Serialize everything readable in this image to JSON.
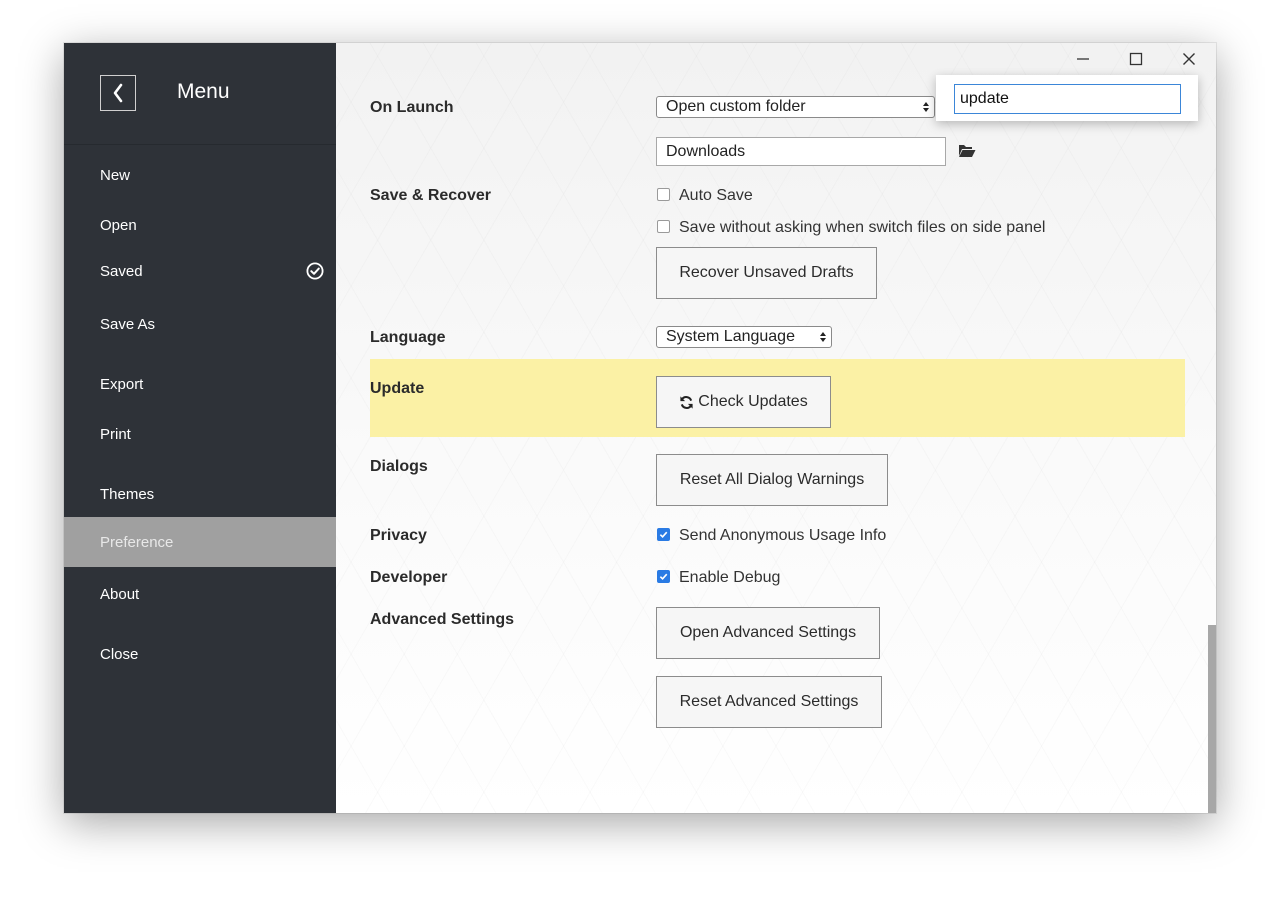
{
  "sidebar": {
    "title": "Menu",
    "items": [
      {
        "label": "New"
      },
      {
        "label": "Open"
      },
      {
        "label": "Saved"
      },
      {
        "label": "Save As"
      },
      {
        "label": "Export"
      },
      {
        "label": "Print"
      },
      {
        "label": "Themes"
      },
      {
        "label": "Preference"
      },
      {
        "label": "About"
      },
      {
        "label": "Close"
      }
    ],
    "active_item": "Preference"
  },
  "settings": {
    "on_launch": {
      "label": "On Launch",
      "select_value": "Open custom folder",
      "folder_value": "Downloads"
    },
    "save_recover": {
      "label": "Save & Recover",
      "auto_save": {
        "label": "Auto Save",
        "checked": false
      },
      "save_without_asking": {
        "label": "Save without asking when switch files on side panel",
        "checked": false
      },
      "recover_button": "Recover Unsaved Drafts"
    },
    "language": {
      "label": "Language",
      "select_value": "System Language"
    },
    "update": {
      "label": "Update",
      "button": "Check Updates"
    },
    "dialogs": {
      "label": "Dialogs",
      "button": "Reset All Dialog Warnings"
    },
    "privacy": {
      "label": "Privacy",
      "checkbox": {
        "label": "Send Anonymous Usage Info",
        "checked": true
      }
    },
    "developer": {
      "label": "Developer",
      "checkbox": {
        "label": "Enable Debug",
        "checked": true
      }
    },
    "advanced": {
      "label": "Advanced Settings",
      "open_button": "Open Advanced Settings",
      "reset_button": "Reset Advanced Settings"
    }
  },
  "search": {
    "value": "update"
  },
  "colors": {
    "sidebar_bg": "#2e3238",
    "active_item_bg": "#a0a0a0",
    "highlight": "#fbf1a5",
    "checkbox_accent": "#2a7be4"
  }
}
